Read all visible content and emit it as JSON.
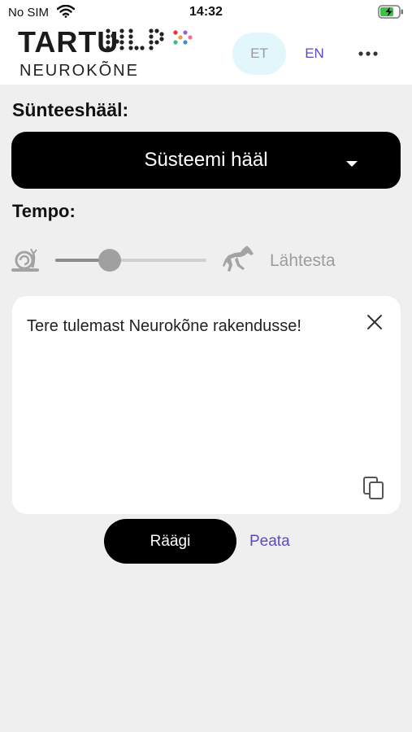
{
  "status_bar": {
    "carrier": "No SIM",
    "time": "14:32"
  },
  "header": {
    "logo_top": "TARTU",
    "logo_top_dotted": "NLP",
    "logo_sub": "NEUROKÕNE",
    "lang_et": "ET",
    "lang_en": "EN",
    "colors": {
      "en_active": "#5b4ac6",
      "et_bg": "#e2f7fb"
    }
  },
  "voice": {
    "label": "Sünteeshääl:",
    "selected": "Süsteemi hääl"
  },
  "tempo": {
    "label": "Tempo:",
    "slow_icon": "snail-icon",
    "fast_icon": "horse-icon",
    "value_fraction": 0.36,
    "reset_label": "Lähtesta"
  },
  "text_card": {
    "text": "Tere tulemast Neurokõne rakendusse!",
    "close_icon": "close-icon",
    "copy_icon": "copy-icon"
  },
  "actions": {
    "speak_label": "Räägi",
    "stop_label": "Peata"
  }
}
